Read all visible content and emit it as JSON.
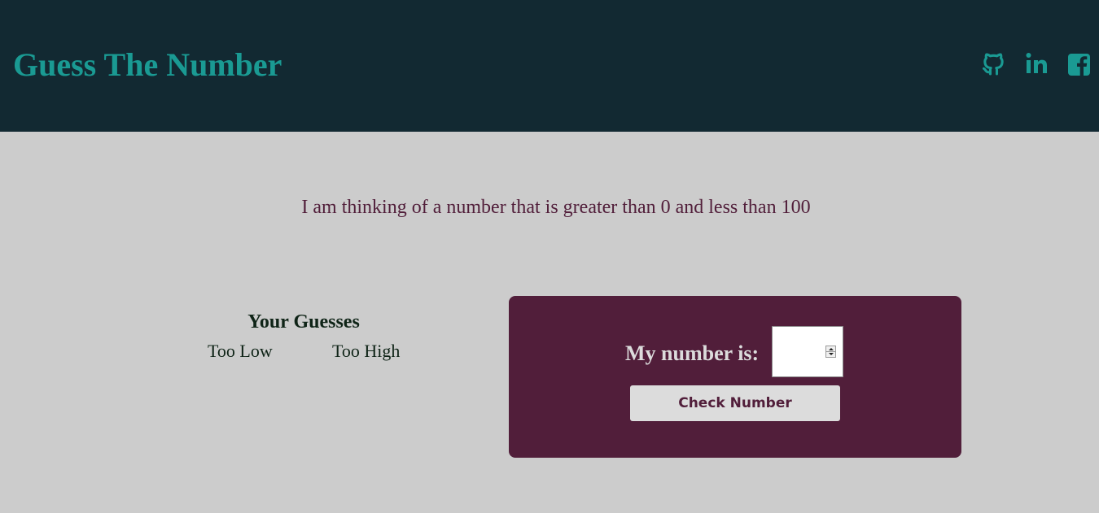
{
  "header": {
    "title": "Guess The Number",
    "background_color": "#122932",
    "accent_color": "#1a9a93",
    "social_links": [
      {
        "icon": "github-icon"
      },
      {
        "icon": "linkedin-icon"
      },
      {
        "icon": "facebook-icon"
      }
    ]
  },
  "main": {
    "background_color": "#cccccc",
    "intro_text": "I am thinking of a number that is greater than 0 and less than 100",
    "intro_color": "#511e3a"
  },
  "guesses": {
    "title": "Your Guesses",
    "too_low_label": "Too Low",
    "too_high_label": "Too High",
    "too_low_values": [],
    "too_high_values": []
  },
  "form": {
    "panel_color": "#511e3a",
    "label": "My number is:",
    "input_value": "",
    "button_label": "Check Number"
  }
}
